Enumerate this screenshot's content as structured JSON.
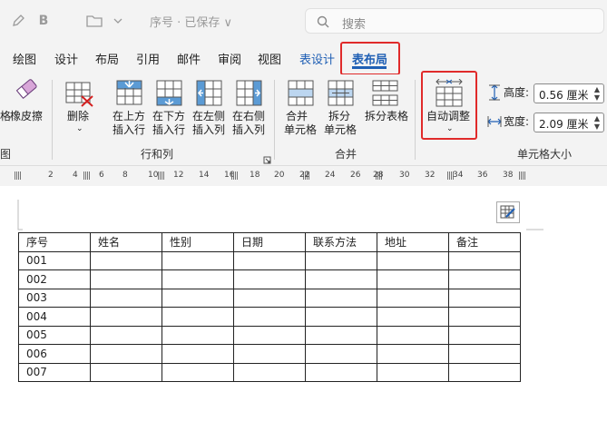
{
  "titlebar": {
    "doc_title": "序号 · 已保存 ∨",
    "search_placeholder": "搜索"
  },
  "tabs": [
    {
      "label": "绘图"
    },
    {
      "label": "设计"
    },
    {
      "label": "布局"
    },
    {
      "label": "引用"
    },
    {
      "label": "邮件"
    },
    {
      "label": "审阅"
    },
    {
      "label": "视图"
    },
    {
      "label": "表设计"
    },
    {
      "label": "表布局"
    }
  ],
  "ribbon": {
    "eraser_prefix": "格",
    "eraser": "橡皮擦",
    "draw_group_label": "图",
    "delete": "删除",
    "insert_above": [
      "在上方",
      "插入行"
    ],
    "insert_below": [
      "在下方",
      "插入行"
    ],
    "insert_left": [
      "在左侧",
      "插入列"
    ],
    "insert_right": [
      "在右侧",
      "插入列"
    ],
    "rows_cols_group": "行和列",
    "merge_cells": [
      "合并",
      "单元格"
    ],
    "split_cells": [
      "拆分",
      "单元格"
    ],
    "split_table": "拆分表格",
    "merge_group": "合并",
    "autofit": "自动调整",
    "height_label": "高度:",
    "height_value": "0.56 厘米",
    "width_label": "宽度:",
    "width_value": "2.09 厘米",
    "cell_size_group": "单元格大小"
  },
  "ruler": [
    "2",
    "4",
    "6",
    "8",
    "10",
    "12",
    "14",
    "16",
    "18",
    "20",
    "22",
    "24",
    "26",
    "28",
    "30",
    "32",
    "34",
    "36",
    "38"
  ],
  "table": {
    "headers": [
      "序号",
      "姓名",
      "性别",
      "日期",
      "联系方法",
      "地址",
      "备注"
    ],
    "rows": [
      [
        "001",
        "",
        "",
        "",
        "",
        "",
        ""
      ],
      [
        "002",
        "",
        "",
        "",
        "",
        "",
        ""
      ],
      [
        "003",
        "",
        "",
        "",
        "",
        "",
        ""
      ],
      [
        "004",
        "",
        "",
        "",
        "",
        "",
        ""
      ],
      [
        "005",
        "",
        "",
        "",
        "",
        "",
        ""
      ],
      [
        "006",
        "",
        "",
        "",
        "",
        "",
        ""
      ],
      [
        "007",
        "",
        "",
        "",
        "",
        "",
        ""
      ]
    ]
  },
  "colors": {
    "accent": "#1f5fb4",
    "highlight": "#e02a2a",
    "ribbon_bg": "#f3f3f3"
  }
}
